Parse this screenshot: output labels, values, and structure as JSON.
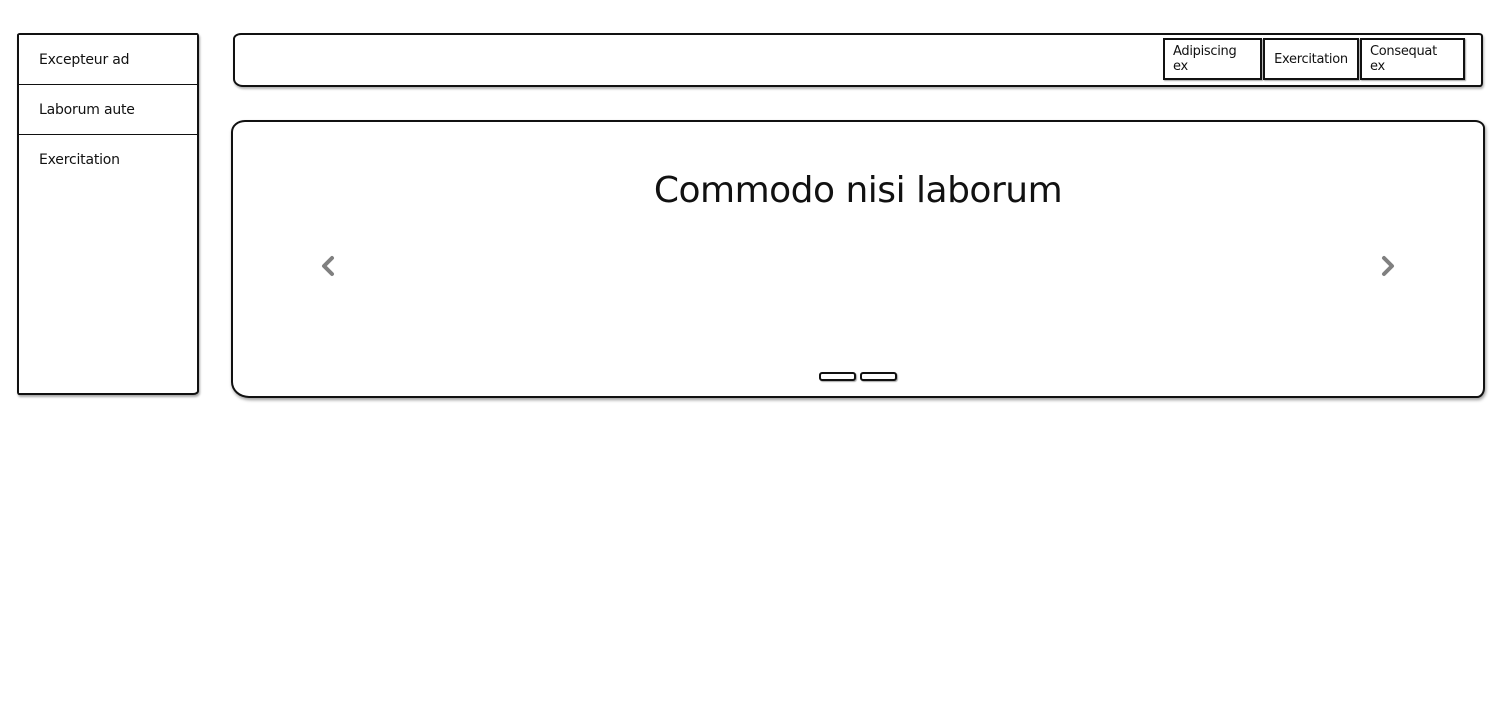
{
  "sidebar": {
    "items": [
      {
        "label": "Excepteur ad"
      },
      {
        "label": "Laborum aute"
      },
      {
        "label": "Exercitation"
      }
    ]
  },
  "topbar": {
    "buttons": [
      {
        "label": "Adipiscing ex"
      },
      {
        "label": "Exercitation"
      },
      {
        "label": "Consequat ex"
      }
    ]
  },
  "carousel": {
    "title": "Commodo nisi laborum",
    "prev_icon": "chevron-left-icon",
    "next_icon": "chevron-right-icon",
    "slide_count": 2,
    "arrow_color": "#808080"
  }
}
